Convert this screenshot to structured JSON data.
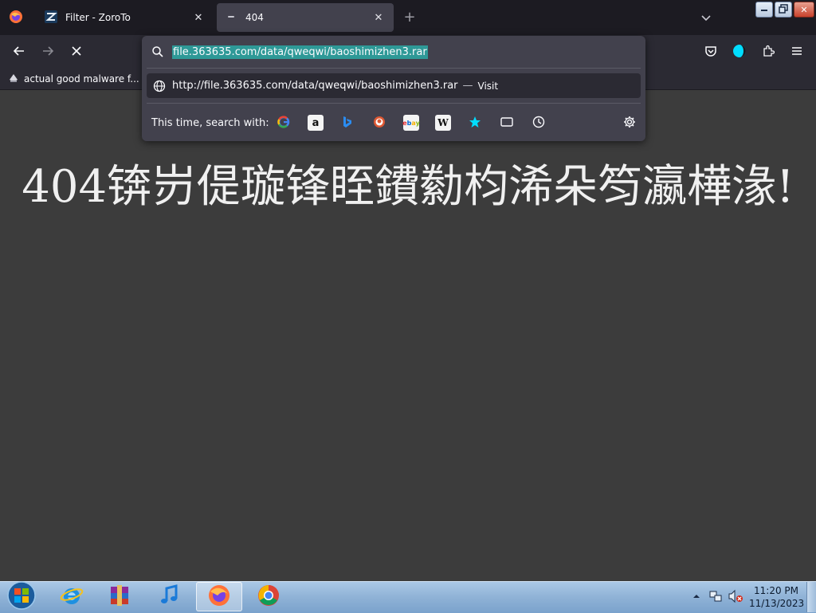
{
  "tabs": [
    {
      "label": "Filter - ZoroTo"
    },
    {
      "label": "404"
    }
  ],
  "newtab_label": "+",
  "urlbar": {
    "value": "file.363635.com/data/qweqwi/baoshimizhen3.rar"
  },
  "suggestion": {
    "url": "http://file.363635.com/data/qweqwi/baoshimizhen3.rar",
    "dash": "—",
    "action": "Visit"
  },
  "search_with": {
    "label": "This time, search with:",
    "engines": [
      "google-icon",
      "amazon-icon",
      "bing-icon",
      "duckduckgo-icon",
      "ebay-icon",
      "wikipedia-icon",
      "bookmarks-icon",
      "tabs-icon",
      "history-icon"
    ]
  },
  "bookmarks": [
    {
      "label": "actual good malware f..."
    }
  ],
  "page": {
    "heading": "404锛岃偍璇锋眰鐨勬枃浠朵笉瀛樺湪!"
  },
  "taskbar": {
    "time": "11:20 PM",
    "date": "11/13/2023"
  },
  "colors": {
    "accent_selection": "#2e9997",
    "content_bg": "#3c3c3c",
    "toolbar_bg": "#2b2a33"
  }
}
